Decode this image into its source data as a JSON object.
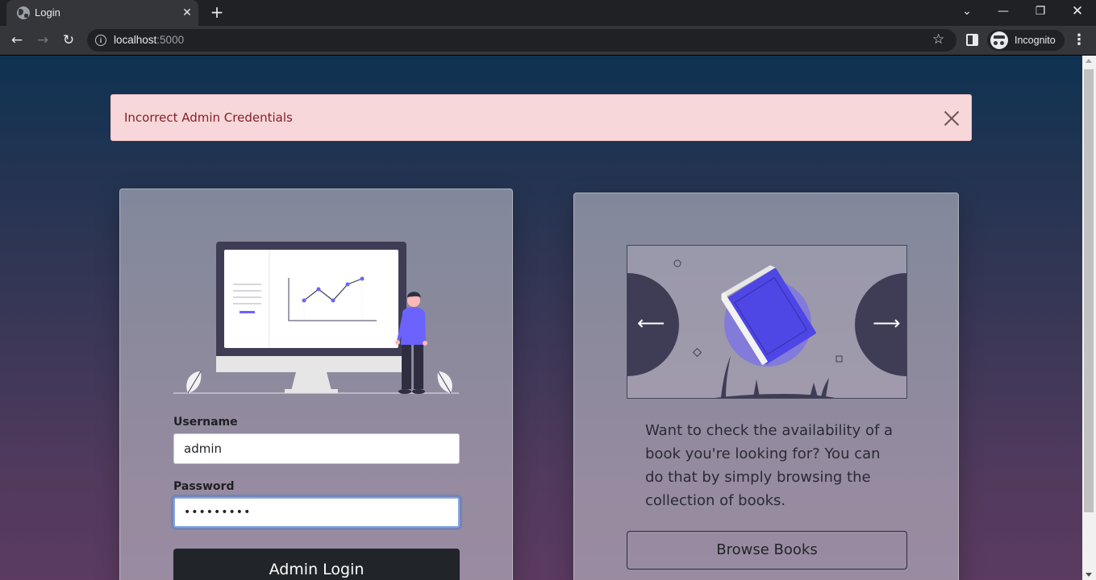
{
  "browser": {
    "tab_title": "Login",
    "url_host": "localhost",
    "url_port": ":5000",
    "incognito_label": "Incognito"
  },
  "alert": {
    "message": "Incorrect Admin Credentials"
  },
  "login_form": {
    "username_label": "Username",
    "username_value": "admin",
    "password_label": "Password",
    "password_value": "•••••••••",
    "submit_label": "Admin Login"
  },
  "promo": {
    "text": "Want to check the availability of a book you're looking for? You can do that by simply browsing the collection of books.",
    "browse_label": "Browse Books",
    "prev_arrow": "⟵",
    "next_arrow": "⟶"
  },
  "colors": {
    "accent": "#6c63ff",
    "alert_bg": "#f8d7da",
    "alert_text": "#842029",
    "dark_button": "#212529"
  }
}
